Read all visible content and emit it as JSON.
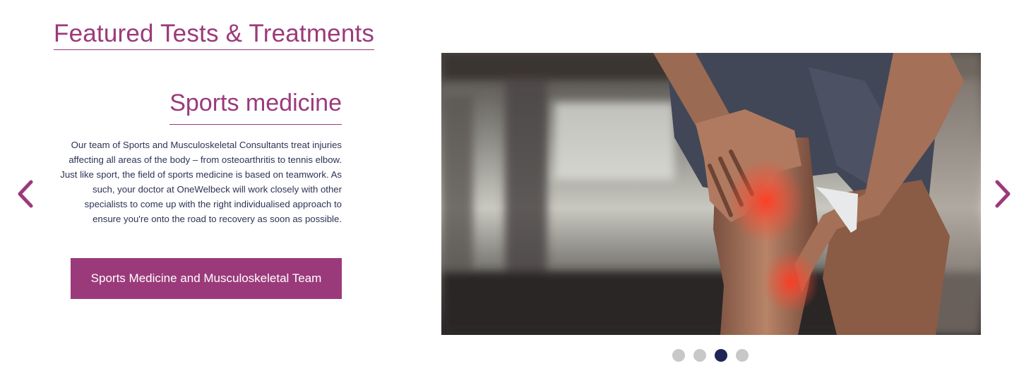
{
  "section": {
    "title": "Featured Tests & Treatments"
  },
  "carousel": {
    "prev_icon": "chevron-left-icon",
    "next_icon": "chevron-right-icon",
    "accent_color": "#9b3a7b",
    "dot_active_color": "#1f2557",
    "dot_inactive_color": "#c8c8c8",
    "slide_count": 4,
    "active_slide": 3,
    "slide": {
      "heading": "Sports medicine",
      "body": "Our team of Sports and Musculoskeletal Consultants treat injuries affecting all areas of the body – from osteoarthritis to tennis elbow. Just like sport, the field of sports medicine is based on teamwork. As such, your doctor at OneWelbeck will work closely with other specialists to come up with the right individualised approach to ensure you're onto the road to recovery as soon as possible.",
      "button_label": "Sports Medicine and Musculoskeletal Team",
      "image": "photo of a person holding a painful knee"
    }
  }
}
